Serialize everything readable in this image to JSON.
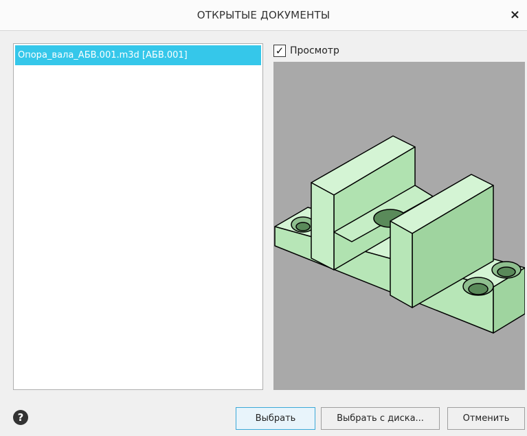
{
  "dialog": {
    "title": "ОТКРЫТЫЕ ДОКУМЕНТЫ",
    "close_label": "×"
  },
  "documents": [
    "Опора_вала_АБВ.001.m3d [АБВ.001]"
  ],
  "preview": {
    "label": "Просмотр",
    "checked": true,
    "check_glyph": "✓",
    "background_color": "#a9a9a9",
    "model_color": "#c9efc9"
  },
  "footer": {
    "help_glyph": "?",
    "select_label": "Выбрать",
    "select_from_disk_label": "Выбрать с диска...",
    "cancel_label": "Отменить"
  },
  "colors": {
    "selection": "#35c7ea",
    "primary_border": "#3aa8d8"
  }
}
